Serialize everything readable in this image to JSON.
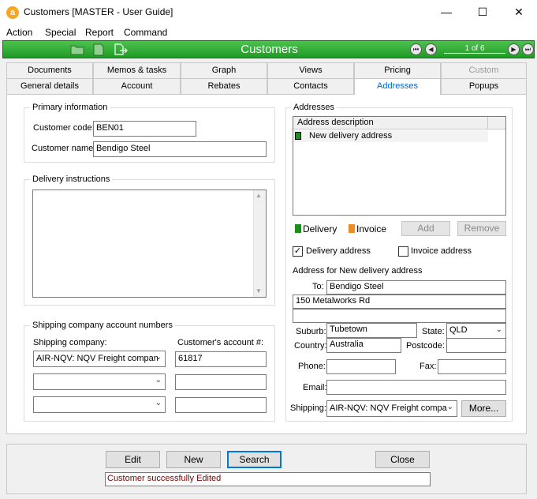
{
  "window": {
    "title": "Customers [MASTER - User Guide]",
    "app_icon_letter": "a",
    "minimize": "—",
    "maximize": "☐",
    "close": "✕"
  },
  "menu": [
    "Action",
    "Special",
    "Report",
    "Command"
  ],
  "toolbar": {
    "title": "Customers",
    "record_position": "1 of 6"
  },
  "tabs_row1": [
    {
      "label": "Documents",
      "state": "normal"
    },
    {
      "label": "Memos & tasks",
      "state": "normal"
    },
    {
      "label": "Graph",
      "state": "normal"
    },
    {
      "label": "Views",
      "state": "normal"
    },
    {
      "label": "Pricing",
      "state": "normal"
    },
    {
      "label": "Custom",
      "state": "disabled"
    }
  ],
  "tabs_row2": [
    {
      "label": "General details",
      "state": "normal"
    },
    {
      "label": "Account",
      "state": "normal"
    },
    {
      "label": "Rebates",
      "state": "normal"
    },
    {
      "label": "Contacts",
      "state": "normal"
    },
    {
      "label": "Addresses",
      "state": "active"
    },
    {
      "label": "Popups",
      "state": "normal"
    }
  ],
  "primary": {
    "title": "Primary information",
    "code_label": "Customer code:",
    "code_value": "BEN01",
    "name_label": "Customer name:",
    "name_value": "Bendigo Steel"
  },
  "delivery_instructions": {
    "title": "Delivery instructions",
    "value": ""
  },
  "shipping_accounts": {
    "title": "Shipping company account numbers",
    "company_header": "Shipping company:",
    "account_header": "Customer's account #:",
    "rows": [
      {
        "company": "AIR-NQV: NQV Freight compan",
        "account": "61817"
      },
      {
        "company": "",
        "account": ""
      },
      {
        "company": "",
        "account": ""
      }
    ]
  },
  "addresses": {
    "title": "Addresses",
    "column_header": "Address description",
    "items": [
      {
        "description": "New delivery address",
        "type": "delivery"
      }
    ],
    "legend_delivery": "Delivery",
    "legend_invoice": "Invoice",
    "delivery_color": "#1a8f1a",
    "invoice_color": "#f08a24",
    "add_label": "Add",
    "remove_label": "Remove",
    "delivery_checkbox": "Delivery address",
    "delivery_checked": "✓",
    "invoice_checkbox": "Invoice address"
  },
  "address_detail": {
    "title": "Address for New delivery address",
    "to_label": "To:",
    "to_value": "Bendigo Steel",
    "line1": "150 Metalworks Rd",
    "line2": "",
    "suburb_label": "Suburb:",
    "suburb_value": "Tubetown",
    "state_label": "State:",
    "state_value": "QLD",
    "country_label": "Country:",
    "country_value": "Australia",
    "postcode_label": "Postcode:",
    "postcode_value": "",
    "phone_label": "Phone:",
    "phone_value": "",
    "fax_label": "Fax:",
    "fax_value": "",
    "email_label": "Email:",
    "email_value": "",
    "shipping_label": "Shipping:",
    "shipping_value": "AIR-NQV: NQV Freight compa",
    "more_label": "More..."
  },
  "footer": {
    "edit": "Edit",
    "new": "New",
    "search": "Search",
    "close": "Close",
    "status": "Customer successfully Edited"
  }
}
